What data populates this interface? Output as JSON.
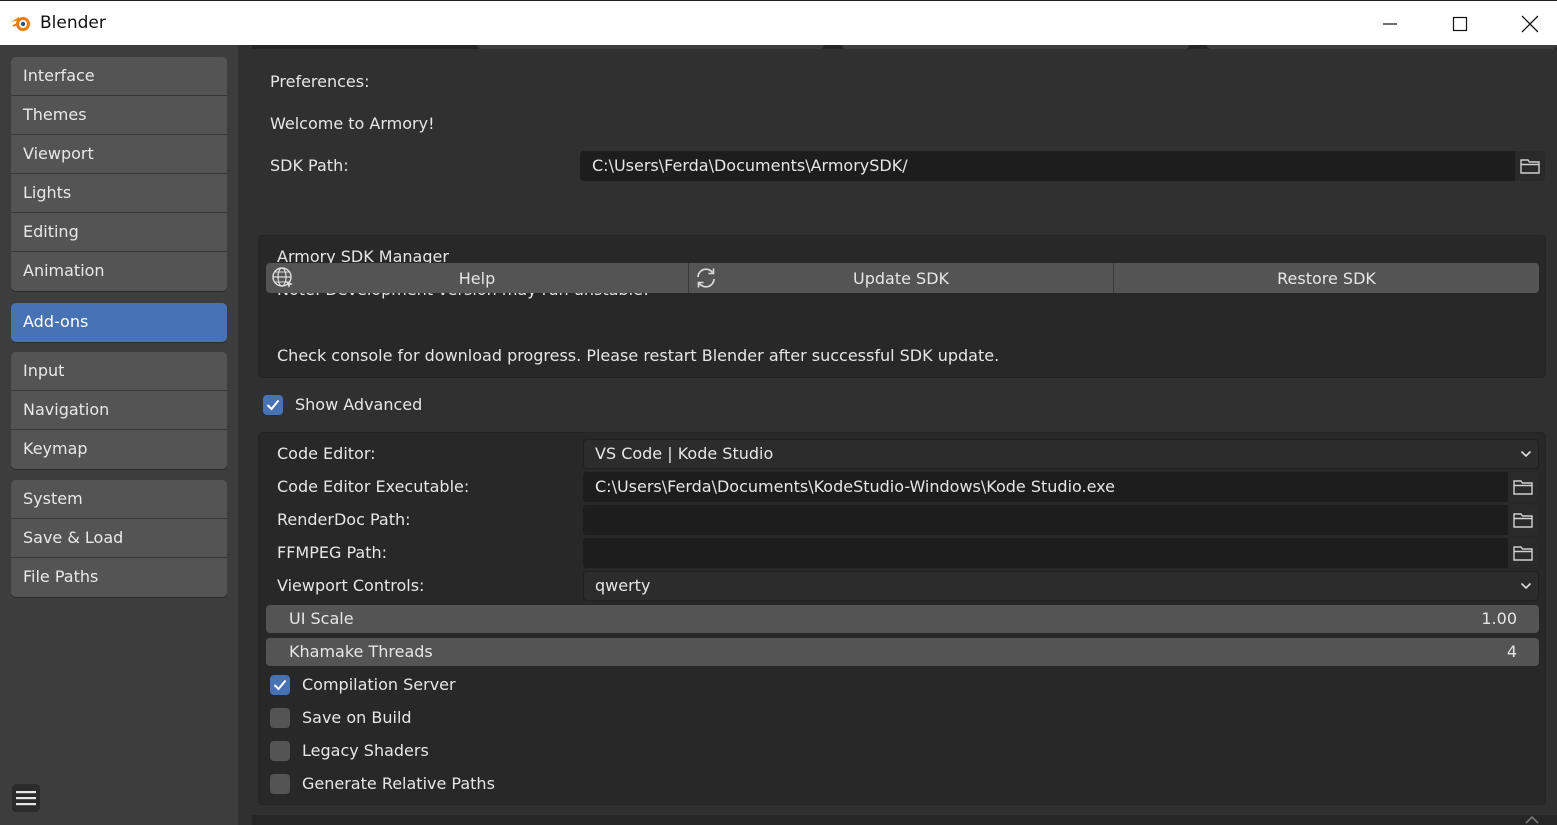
{
  "window": {
    "title": "Blender"
  },
  "sidebar": {
    "groups": [
      [
        "Interface",
        "Themes",
        "Viewport",
        "Lights",
        "Editing",
        "Animation"
      ],
      [
        "Add-ons"
      ],
      [
        "Input",
        "Navigation",
        "Keymap"
      ],
      [
        "System",
        "Save & Load",
        "File Paths"
      ]
    ],
    "active": "Add-ons"
  },
  "prefs": {
    "heading": "Preferences:",
    "welcome": "Welcome to Armory!",
    "sdk_path_label": "SDK Path:",
    "sdk_path_value": "C:\\Users\\Ferda\\Documents\\ArmorySDK/"
  },
  "sdk_manager": {
    "title": "Armory SDK Manager",
    "note": "Note: Development version may run unstable!",
    "help_label": "Help",
    "update_label": "Update SDK",
    "restore_label": "Restore SDK",
    "info": "Check console for download progress. Please restart Blender after successful SDK update."
  },
  "show_advanced": {
    "label": "Show Advanced",
    "checked": true
  },
  "advanced": {
    "code_editor_label": "Code Editor:",
    "code_editor_value": "VS Code | Kode Studio",
    "code_editor_exe_label": "Code Editor Executable:",
    "code_editor_exe_value": "C:\\Users\\Ferda\\Documents\\KodeStudio-Windows\\Kode Studio.exe",
    "renderdoc_label": "RenderDoc Path:",
    "renderdoc_value": "",
    "ffmpeg_label": "FFMPEG Path:",
    "ffmpeg_value": "",
    "viewport_controls_label": "Viewport Controls:",
    "viewport_controls_value": "qwerty",
    "ui_scale_label": "UI Scale",
    "ui_scale_value": "1.00",
    "khamake_label": "Khamake Threads",
    "khamake_value": "4",
    "options": [
      {
        "label": "Compilation Server",
        "checked": true
      },
      {
        "label": "Save on Build",
        "checked": false
      },
      {
        "label": "Legacy Shaders",
        "checked": false
      },
      {
        "label": "Generate Relative Paths",
        "checked": false
      }
    ]
  },
  "colors": {
    "accent": "#4772b3",
    "background": "#303030",
    "sidebar": "#3d3d3d",
    "button": "#545454",
    "field": "#1d1d1d"
  },
  "icons": {
    "app": "blender-logo-icon",
    "minimize": "minimize-icon",
    "maximize": "maximize-icon",
    "close": "close-icon",
    "folder": "folder-icon",
    "help": "globe-icon",
    "update": "refresh-icon",
    "menu": "hamburger-menu-icon",
    "check": "check-icon",
    "dropdown": "chevron-down-icon"
  }
}
